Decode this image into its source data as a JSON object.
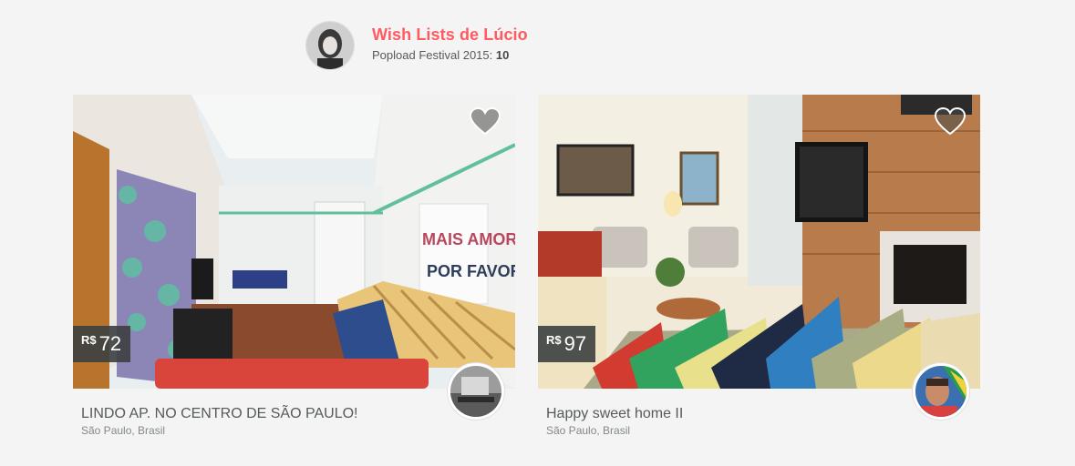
{
  "header": {
    "title": "Wish Lists de Lúcio",
    "subtitle_label": "Popload Festival 2015:",
    "subtitle_count": "10"
  },
  "listings": [
    {
      "title": "LINDO AP. NO CENTRO DE SÃO PAULO!",
      "location": "São Paulo, Brasil",
      "currency": "R$",
      "price": "72",
      "heart_icon": "heart-icon"
    },
    {
      "title": "Happy sweet home II",
      "location": "São Paulo, Brasil",
      "currency": "R$",
      "price": "97",
      "heart_icon": "heart-icon"
    }
  ],
  "photo_poster_text": [
    "MAIS AMOR",
    "POR FAVOR"
  ],
  "colors": {
    "accent": "#ff5a5f",
    "price_badge": "#3c3f40",
    "text": "#565a5c"
  }
}
